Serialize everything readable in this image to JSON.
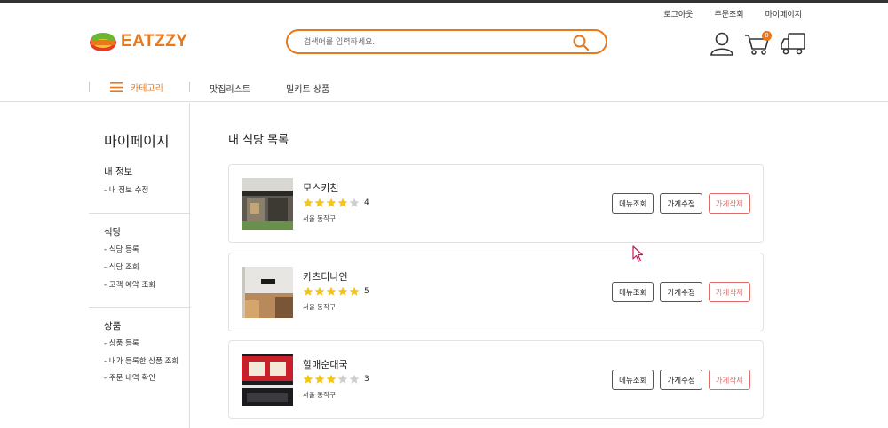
{
  "header": {
    "util_links": [
      "로그아웃",
      "주문조회",
      "마이페이지"
    ],
    "logo_text_1": "EATZZY",
    "search_placeholder": "검색어를 입력하세요.",
    "cart_count": "0"
  },
  "gnb": {
    "category_label": "카테고리",
    "links": [
      "맛집리스트",
      "밀키트 상품"
    ]
  },
  "sidebar": {
    "title": "마이페이지",
    "groups": [
      {
        "title": "내 정보",
        "items": [
          "- 내 정보 수정"
        ]
      },
      {
        "title": "식당",
        "items": [
          "- 식당 등록",
          "- 식당 조회",
          "- 고객 예약 조회"
        ]
      },
      {
        "title": "상품",
        "items": [
          "- 상품 등록",
          "- 내가 등록한 상품 조회",
          "- 주문 내역 확인"
        ]
      }
    ]
  },
  "main": {
    "title": "내 식당 목록",
    "restaurants": [
      {
        "name": "모스키친",
        "rating": "4",
        "stars": 4,
        "address": "서울 동작구"
      },
      {
        "name": "카츠디나인",
        "rating": "5",
        "stars": 5,
        "address": "서울 동작구"
      },
      {
        "name": "할매순대국",
        "rating": "3",
        "stars": 3,
        "address": "서울 동작구"
      }
    ],
    "buttons": {
      "menu": "메뉴조회",
      "edit": "가게수정",
      "delete": "가게삭제"
    }
  },
  "colors": {
    "accent": "#e8781c",
    "green": "#6bb632",
    "star": "#f5c518",
    "delete": "#e06b6b"
  },
  "icons": [
    "search-icon",
    "user-icon",
    "cart-icon",
    "truck-icon",
    "menu-icon",
    "star-icon"
  ]
}
